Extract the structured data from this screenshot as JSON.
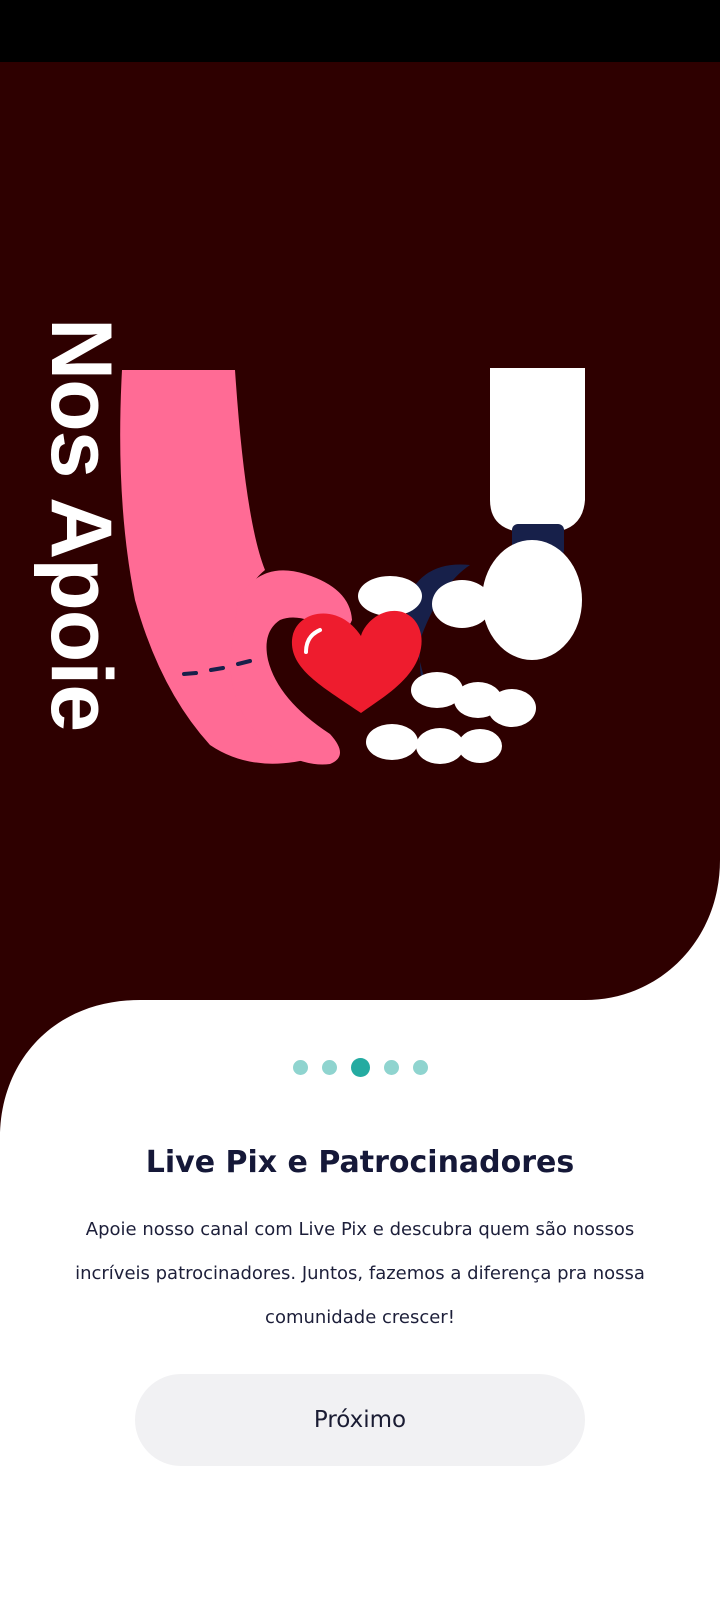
{
  "hero": {
    "vertical_title": "Nos Apoie",
    "background_color": "#2e0000",
    "illustration_icon": "hands-heart-icon"
  },
  "pager": {
    "total": 5,
    "active_index": 2,
    "active_color": "#24aba1",
    "inactive_color": "#8fd4cf"
  },
  "slide": {
    "title": "Live Pix e Patrocinadores",
    "description": "Apoie nosso canal com Live Pix e descubra quem são nossos incríveis patrocinadores. Juntos, fazemos a diferença pra nossa comunidade crescer!"
  },
  "actions": {
    "next_label": "Próximo"
  }
}
